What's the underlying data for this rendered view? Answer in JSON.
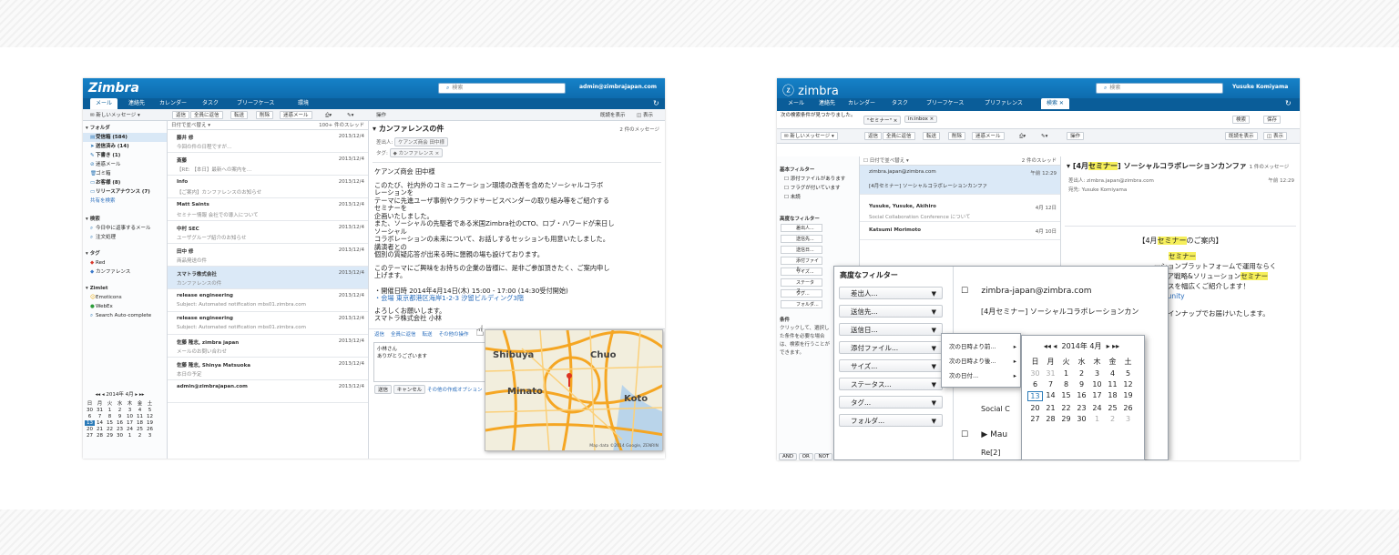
{
  "left": {
    "app": {
      "logo": "Zimbra",
      "search_placeholder": "検索",
      "user": "admin@zimbrajapan.com"
    },
    "tabs": [
      "メール",
      "連絡先",
      "カレンダー",
      "タスク",
      "ブリーフケース",
      "環境"
    ],
    "toolbar": {
      "new_message": "新しいメッセージ",
      "buttons": [
        "返信",
        "全員に返信",
        "転送",
        "削除",
        "迷惑メール",
        "操作"
      ],
      "read_more": "既読を表示",
      "view": "表示"
    },
    "sidebar": {
      "folders_header": "フォルダ",
      "folders": [
        "受信箱 (584)",
        "送信済み (14)",
        "下書き (1)",
        "迷惑メール",
        "ゴミ箱",
        "お客様 (8)",
        "リリースアナウンス (7)"
      ],
      "add_folder": "共有を検索",
      "search_header": "検索",
      "searches": [
        "今日中に返事するメール",
        "注文処理"
      ],
      "tags_header": "タグ",
      "tags": [
        "Red",
        "カンファレンス"
      ],
      "zimlets_header": "Zimlet",
      "zimlets": [
        "Emoticons",
        "WebEx",
        "Search Auto-complete"
      ],
      "calendar": {
        "title": "2014年 4月",
        "weekdays": [
          "日",
          "月",
          "火",
          "水",
          "木",
          "金",
          "土"
        ],
        "days": [
          "30",
          "31",
          "1",
          "2",
          "3",
          "4",
          "5",
          "6",
          "7",
          "8",
          "9",
          "10",
          "11",
          "12",
          "13",
          "14",
          "15",
          "16",
          "17",
          "18",
          "19",
          "20",
          "21",
          "22",
          "23",
          "24",
          "25",
          "26",
          "27",
          "28",
          "29",
          "30",
          "1",
          "2",
          "3"
        ],
        "today": "13"
      }
    },
    "list": {
      "sort": "日付で並べ替え",
      "count": "100+ 件のスレッド",
      "rows": [
        {
          "from": "藤井 修",
          "date": "2013/12/4",
          "snip": "今回の件の日程ですが…"
        },
        {
          "from": "斎藤",
          "date": "2013/12/4",
          "snip": "【RE: 【本日】最新への案内を…"
        },
        {
          "from": "Info",
          "date": "2013/12/4",
          "snip": "【ご案内】カンファレンスのお知らせ"
        },
        {
          "from": "Matt Saints",
          "date": "2013/12/4",
          "snip": "セミナー情報 会社での導入について"
        },
        {
          "from": "中村 SEC",
          "date": "2013/12/4",
          "snip": "ユーザグループ紹介のお知らせ"
        },
        {
          "from": "田中 修",
          "date": "2013/12/4",
          "snip": "商品発送の件"
        },
        {
          "from": "スマトラ株式会社",
          "date": "2013/12/4",
          "snip": "カンファレンスの件"
        },
        {
          "from": "release engineering",
          "date": "2013/12/4",
          "snip": "Subject: Automated notification mbs01.zimbra.com"
        },
        {
          "from": "release engineering",
          "date": "2013/12/4",
          "snip": "Subject: Automated notification mbs01.zimbra.com"
        },
        {
          "from": "佐藤 隆志, zimbra japan",
          "date": "2013/12/4",
          "snip": "メールのお問い合わせ"
        },
        {
          "from": "佐藤 隆志, Shinya Matsuoka",
          "date": "2013/12/4",
          "snip": "本日の予定"
        },
        {
          "from": "admin@zimbrajapan.com",
          "date": "2013/12/4",
          "snip": ""
        }
      ]
    },
    "reading": {
      "subject": "カンファレンスの件",
      "count": "2 件のメッセージ",
      "from_label": "差出人:",
      "from": "ケアンズ商会 田中様",
      "tag_label": "タグ:",
      "tag": "カンファレンス",
      "body": [
        "ケアンズ商会 田中様",
        "",
        "このたび、社内外のコミュニケーション環境の改善を含めたソーシャルコラボ",
        "レーションを",
        "テーマに先進ユーザ事例やクラウドサービスベンダーの取り組み等をご紹介する",
        "セミナーを",
        "企画いたしました。",
        "また、ソーシャルの先駆者である米国Zimbra社のCTO、ロブ・ハワードが来日し",
        "ソーシャル",
        "コラボレーションの未来について、お話しするセッションも用意いたしました。",
        "講演者との",
        "個別の質疑応答が出来る時に懇親の場も設けております。",
        "",
        "このテーマにご興味をお持ちの企業の皆様に、是非ご参加頂きたく、ご案内申し",
        "上げます。"
      ],
      "event_date": "・開催日時 2014年4月14日(木) 15:00 - 17:00 (14:30受付開始)",
      "event_place": "・会場 東京都港区海岸1-2-3 汐留ビルディング3階",
      "closing": [
        "よろしくお願いします。",
        "スマトラ株式会社 小林"
      ],
      "actions": [
        "返信",
        "全員に返信",
        "転送",
        "その他の操作"
      ],
      "reply_text": [
        "小林さん",
        "ありがとうございます"
      ],
      "reply_buttons": [
        "送信",
        "キャンセル"
      ],
      "reply_link": "その他の作成オプション"
    },
    "map": {
      "labels": [
        "Shibuya",
        "Chuo",
        "Minato",
        "Koto"
      ],
      "credit": "Map data ©2014 Google, ZENRIN"
    }
  },
  "right": {
    "app": {
      "logo": "zimbra",
      "search_placeholder": "検索",
      "user": "Yusuke Komiyama"
    },
    "tabs": [
      "メール",
      "連絡先",
      "カレンダー",
      "タスク",
      "ブリーフケース",
      "プリファレンス",
      "検索"
    ],
    "search_bar": {
      "hint": "次の検索条件が見つかりました。",
      "chip1": "\"セミナー\"",
      "chip2": "in:inbox",
      "buttons": [
        "検索",
        "保存"
      ]
    },
    "toolbar": {
      "new_message": "新しいメッセージ",
      "buttons": [
        "返信",
        "全員に返信",
        "転送",
        "削除",
        "迷惑メール",
        "操作"
      ],
      "read_more": "既読を表示",
      "view": "表示"
    },
    "sidebar": {
      "basic_header": "基本フィルター",
      "basic": [
        "添付ファイルがあります",
        "フラグが付いています",
        "未読"
      ],
      "advanced_header": "高度なフィルター",
      "advanced_small": [
        "差出人...",
        "送信先...",
        "送信日...",
        "添付ファイル...",
        "サイズ...",
        "ステータス...",
        "タグ...",
        "フォルダ..."
      ],
      "conditions_header": "条件",
      "conditions_text": [
        "クリックして、選択し",
        "た条件を必要な場合",
        "は、検索を行うことが",
        "できます。"
      ]
    },
    "list": {
      "sort": "日付で並べ替え",
      "count": "2 件のスレッド",
      "rows": [
        {
          "from": "zimbra.japan@zimbra.com",
          "date": "午前 12:29",
          "snip": "[4月セミナー] ソーシャルコラボレーションカンファ"
        },
        {
          "from": "Yusuke, Yusuke, Akihiro",
          "date": "4月 12日",
          "snip": "Social Collaboration Conference について"
        },
        {
          "from": "Katsumi Morimoto",
          "date": "4月 10日",
          "snip": ""
        }
      ]
    },
    "reading": {
      "subject_prefix": "[4月",
      "subject_hl": "セミナー",
      "subject_rest": "] ソーシャルコラボレーションカンファ",
      "count": "1 件のメッセージ",
      "from_label": "差出人:",
      "from": "zimbra.japan@zimbra.com",
      "to_label": "宛先:",
      "to": "Yusuke Komiyama",
      "date": "午前 12:29",
      "notice_prefix": "【4月",
      "notice_hl": "セミナー",
      "notice_rest": "のご案内】",
      "body": [
        {
          "pre": "",
          "hl": "セミナー",
          "post": ""
        },
        {
          "pre": "ーションプラットフォームで運用ならく",
          "hl": "",
          "post": ""
        },
        {
          "pre": "ディア戦略&ソリューション",
          "hl": "セミナー",
          "post": ""
        },
        {
          "pre": "ービスを幅広くご紹介します！",
          "hl": "",
          "post": ""
        },
        {
          "pre": "mmunity",
          "hl": "",
          "post": ""
        },
        {
          "pre": "",
          "hl": "",
          "post": ""
        },
        {
          "pre": "いラインナップでお届けいたします。",
          "hl": "",
          "post": ""
        }
      ]
    },
    "advanced_panel": {
      "title": "高度なフィルター",
      "filters": [
        "差出人...",
        "送信先...",
        "送信日...",
        "添付ファイル...",
        "サイズ...",
        "ステータス...",
        "タグ...",
        "フォルダ..."
      ],
      "email": "zimbra-japan@zimbra.com",
      "subject": "[4月セミナー] ソーシャルコラボレーションカン",
      "row2_snip": "Social C",
      "row3_snip": "Mau",
      "row4_snip": "Re[2]",
      "date_menu": [
        "次の日時より前...",
        "次の日時より後...",
        "次の日付..."
      ],
      "calendar": {
        "title": "2014年 4月",
        "weekdays": [
          "日",
          "月",
          "火",
          "水",
          "木",
          "金",
          "土"
        ],
        "days": [
          "30",
          "31",
          "1",
          "2",
          "3",
          "4",
          "5",
          "6",
          "7",
          "8",
          "9",
          "10",
          "11",
          "12",
          "13",
          "14",
          "15",
          "16",
          "17",
          "18",
          "19",
          "20",
          "21",
          "22",
          "23",
          "24",
          "25",
          "26",
          "27",
          "28",
          "29",
          "30",
          "1",
          "2",
          "3"
        ],
        "today": "13"
      },
      "bottom_buttons": [
        "AND",
        "OR",
        "NOT"
      ]
    }
  },
  "colors": {
    "header_blue": "#1682c8",
    "tab_bar": "#0a5d99",
    "selection": "#dbe9f7",
    "highlight": "#f6ef5b",
    "map_roads": "#f5a623"
  }
}
